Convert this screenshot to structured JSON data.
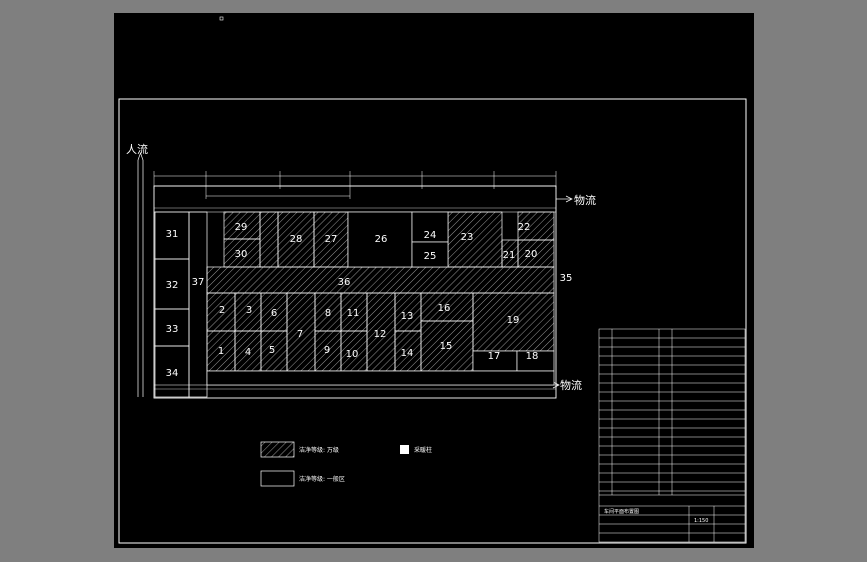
{
  "flow_labels": {
    "people": "人流",
    "goods_top": "物流",
    "goods_bottom": "物流"
  },
  "rooms": {
    "r1": "1",
    "r2": "2",
    "r3": "3",
    "r4": "4",
    "r5": "5",
    "r6": "6",
    "r7": "7",
    "r8": "8",
    "r9": "9",
    "r10": "10",
    "r11": "11",
    "r12": "12",
    "r13": "13",
    "r14": "14",
    "r15": "15",
    "r16": "16",
    "r17": "17",
    "r18": "18",
    "r19": "19",
    "r20": "20",
    "r21": "21",
    "r22": "22",
    "r23": "23",
    "r24": "24",
    "r25": "25",
    "r26": "26",
    "r27": "27",
    "r28": "28",
    "r29": "29",
    "r30": "30",
    "r31": "31",
    "r32": "32",
    "r33": "33",
    "r34": "34",
    "r35": "35",
    "r36": "36",
    "r37": "37"
  },
  "legend": {
    "hatched_label": "洁净等级: 万级",
    "plain_label": "洁净等级: 一般区",
    "square_label": "采暖柱"
  },
  "title_block": {
    "title": "车间平面布置图",
    "scale": "1:150"
  },
  "colors": {
    "line": "#ffffff",
    "background": "#000000",
    "outer": "#7f7f7f"
  }
}
